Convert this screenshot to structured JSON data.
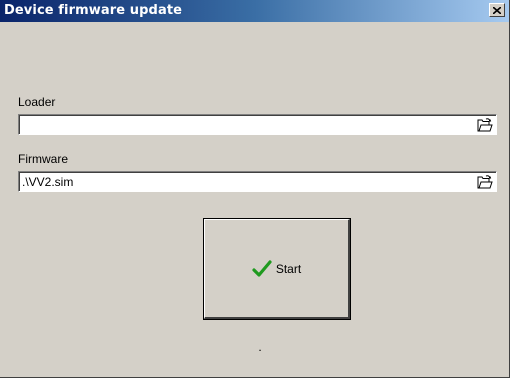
{
  "window": {
    "title": "Device firmware update"
  },
  "loader": {
    "label": "Loader",
    "value": ""
  },
  "firmware": {
    "label": "Firmware",
    "value": ".\\VV2.sim"
  },
  "start_button": {
    "label": "Start"
  },
  "status": {
    "text": "."
  },
  "icons": {
    "close": "close-icon",
    "browse": "open-folder-icon",
    "start": "checkmark-icon"
  },
  "colors": {
    "title_start": "#0a246a",
    "title_end": "#a6caf0",
    "window_bg": "#d4d0c8",
    "check_green": "#1f9a1f"
  }
}
